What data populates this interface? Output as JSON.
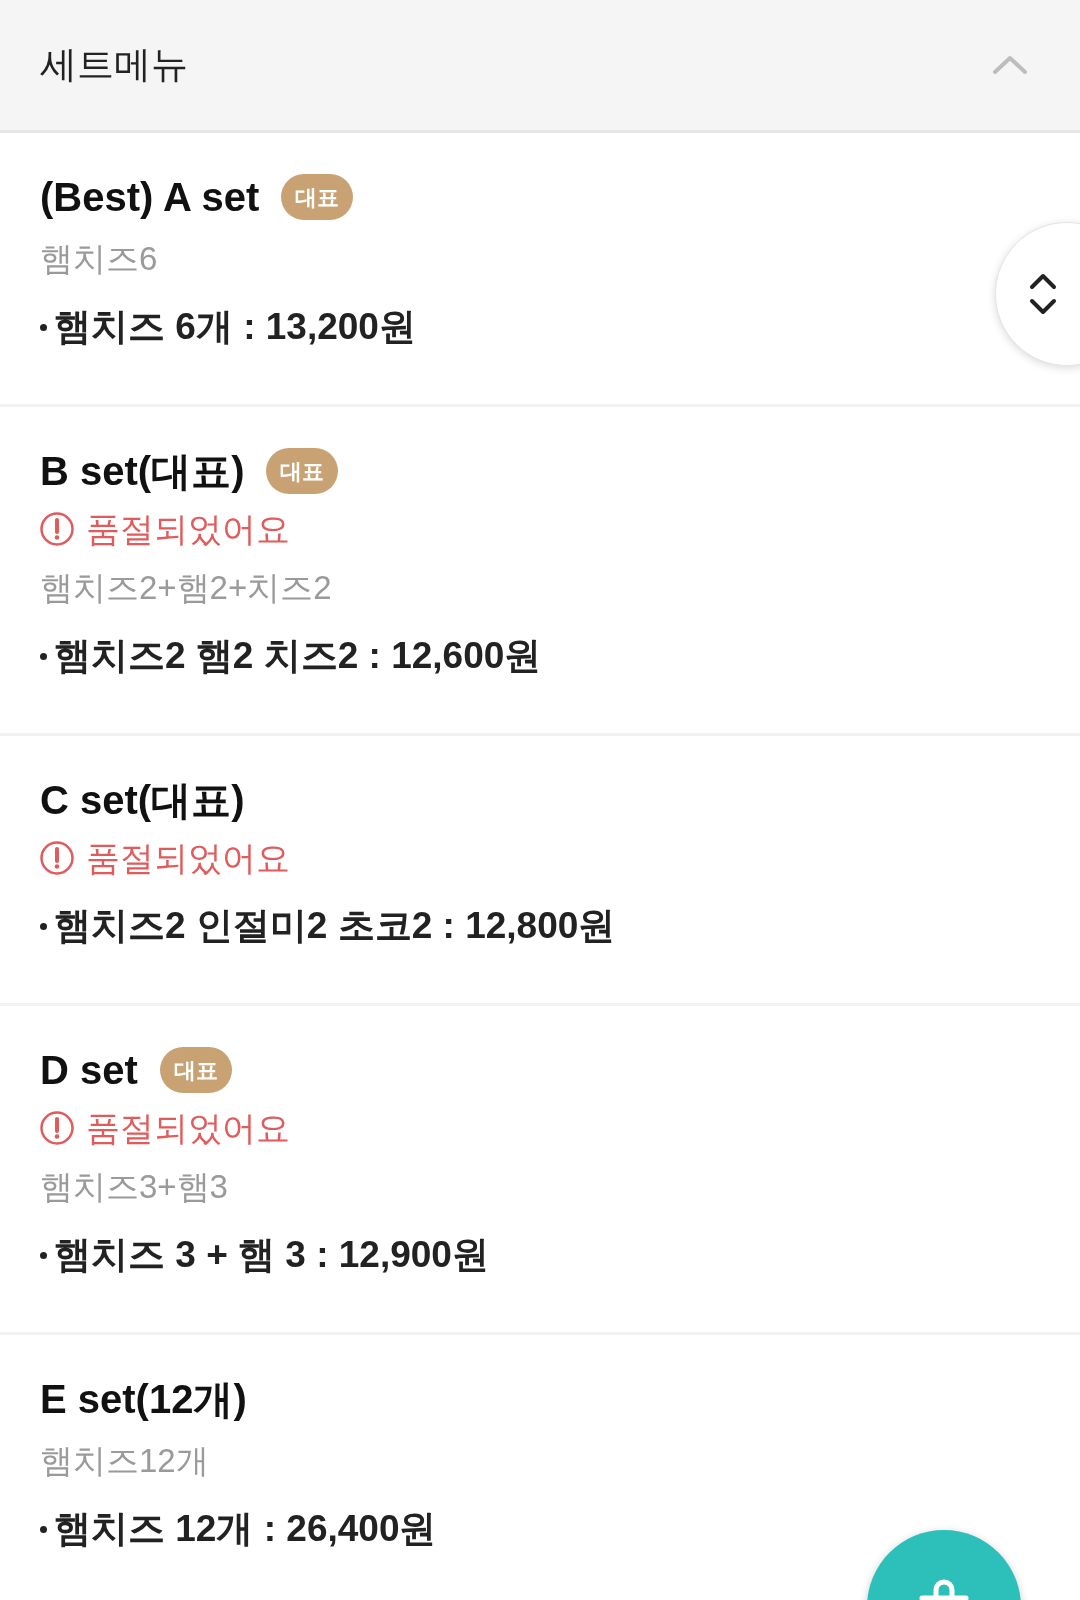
{
  "section": {
    "title": "세트메뉴",
    "expanded": true
  },
  "items": [
    {
      "name": "(Best) A set",
      "badge": "대표",
      "description": "햄치즈6",
      "price_line": "햄치즈 6개 : 13,200원"
    },
    {
      "name": "B set(대표)",
      "badge": "대표",
      "notice": "품절되었어요",
      "description": "햄치즈2+햄2+치즈2",
      "price_line": "햄치즈2 햄2 치즈2 : 12,600원"
    },
    {
      "name": "C set(대표)",
      "notice": "품절되었어요",
      "price_line": "햄치즈2 인절미2 초코2 : 12,800원"
    },
    {
      "name": "D set",
      "badge": "대표",
      "notice": "품절되었어요",
      "description": "햄치즈3+햄3",
      "price_line": "햄치즈 3 + 햄 3 : 12,900원"
    },
    {
      "name": "E set(12개)",
      "description": "햄치즈12개",
      "price_line": "햄치즈 12개 : 26,400원"
    }
  ]
}
